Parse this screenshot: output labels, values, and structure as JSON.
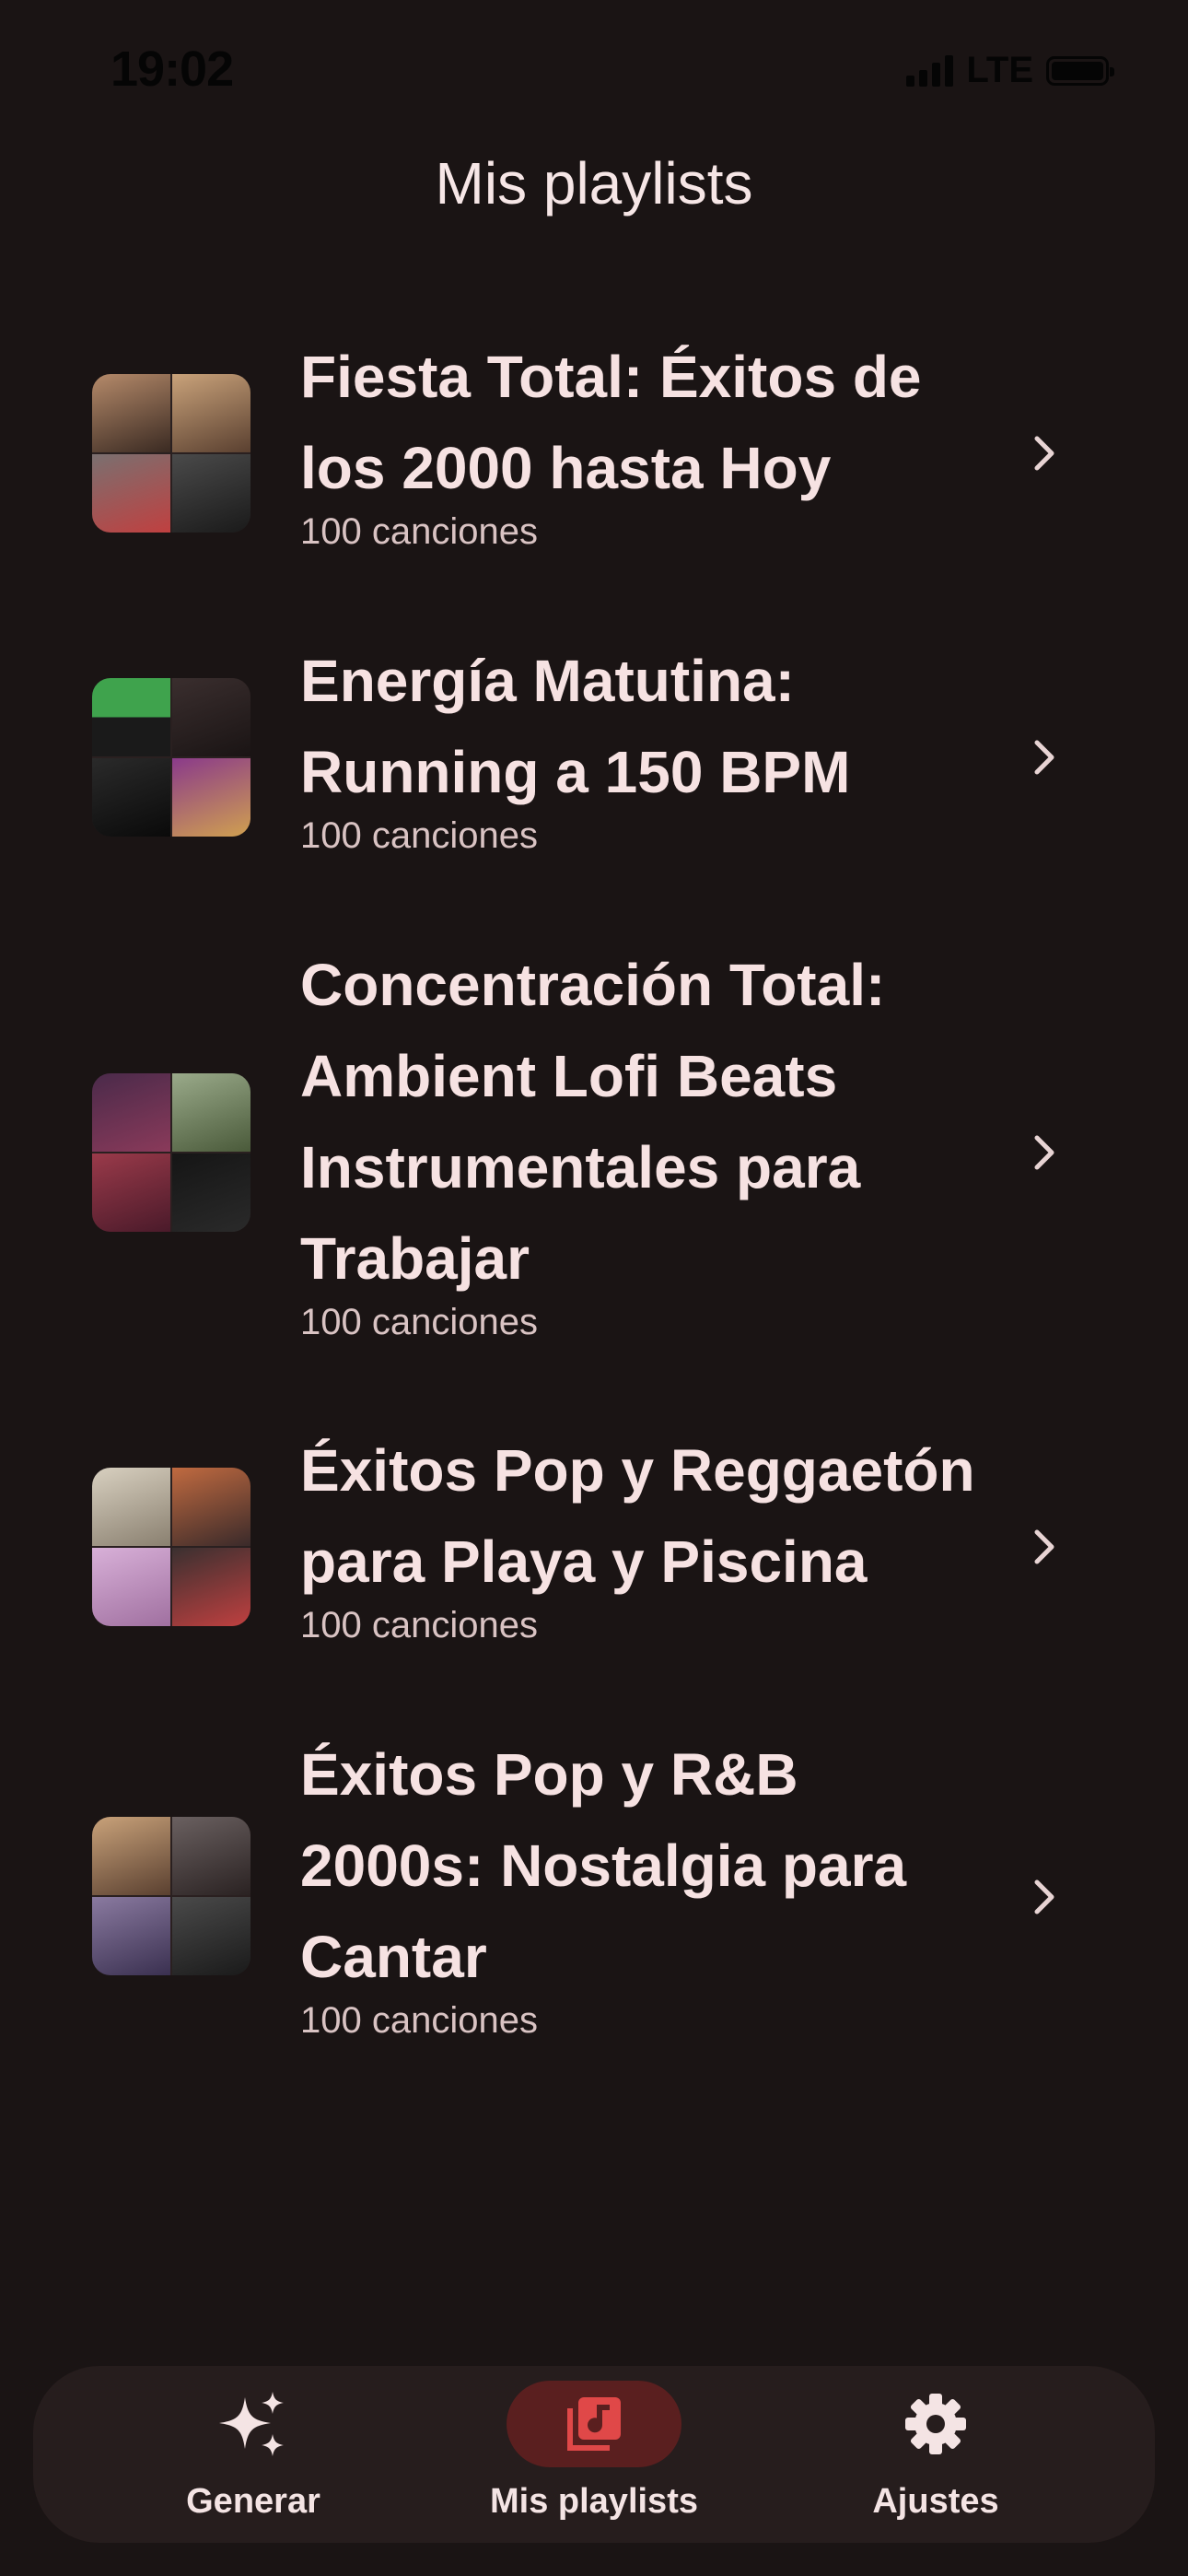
{
  "status_bar": {
    "time": "19:02",
    "network": "LTE"
  },
  "header": {
    "title": "Mis playlists"
  },
  "playlists": [
    {
      "title_lines": [
        "Fiesta Total: Éxitos de",
        "los 2000 hasta Hoy"
      ],
      "count": "100 canciones",
      "cover_colors": [
        "#8a6a5a",
        "#b48a6a",
        "#5a5a5a",
        "#3a3a3a"
      ]
    },
    {
      "title_lines": [
        "Energía Matutina:",
        "Running a 150 BPM"
      ],
      "count": "100 canciones",
      "cover_colors": [
        "#3fa34d",
        "#3a2a2a",
        "#222222",
        "#7a3a7a"
      ]
    },
    {
      "title_lines": [
        "Concentración Total:",
        "Ambient Lofi Beats",
        "Instrumentales para",
        "Trabajar"
      ],
      "count": "100 canciones",
      "cover_colors": [
        "#5a2a4a",
        "#7a8a6a",
        "#8a2a3a",
        "#111111"
      ]
    },
    {
      "title_lines": [
        "Éxitos Pop y Reggaetón",
        "para Playa y Piscina"
      ],
      "count": "100 canciones",
      "cover_colors": [
        "#c8c0b0",
        "#a55a3a",
        "#c8a0c8",
        "#2a2a2a"
      ]
    },
    {
      "title_lines": [
        "Éxitos Pop y R&B",
        "2000s: Nostalgia para",
        "Cantar"
      ],
      "count": "100 canciones",
      "cover_colors": [
        "#b48a6a",
        "#5a5a5a",
        "#6a6a9a",
        "#3a3a3a"
      ]
    }
  ],
  "bottom_nav": {
    "items": [
      {
        "label": "Generar",
        "icon": "sparkles-icon"
      },
      {
        "label": "Mis playlists",
        "icon": "music-library-icon",
        "active": true
      },
      {
        "label": "Ajustes",
        "icon": "gear-icon"
      }
    ],
    "active_color": "#e04848"
  }
}
